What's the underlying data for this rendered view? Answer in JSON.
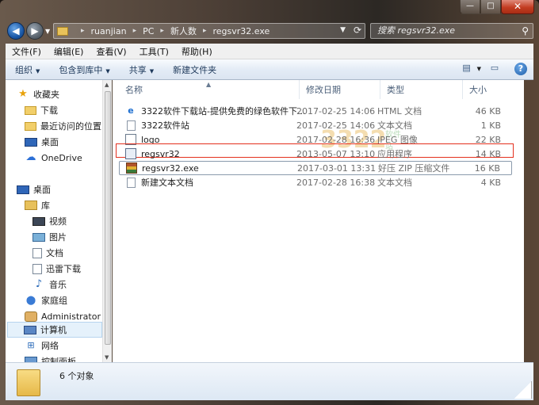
{
  "window": {
    "close_glyph": "✕",
    "min_glyph": "—",
    "max_glyph": "□"
  },
  "address": {
    "crumbs": [
      "ruanjian",
      "PC",
      "新人数",
      "regsvr32.exe"
    ],
    "separator": "▸"
  },
  "search": {
    "placeholder": "搜索 regsvr32.exe"
  },
  "menubar": [
    "文件(F)",
    "编辑(E)",
    "查看(V)",
    "工具(T)",
    "帮助(H)"
  ],
  "toolbar": {
    "organize": "组织",
    "include_in_library": "包含到库中",
    "share": "共享",
    "new_folder": "新建文件夹"
  },
  "navpane": {
    "favorites": "收藏夹",
    "downloads": "下载",
    "recent": "最近访问的位置",
    "desktop_fav": "桌面",
    "onedrive": "OneDrive",
    "desktop": "桌面",
    "libraries": "库",
    "videos": "视频",
    "pictures": "图片",
    "documents": "文档",
    "xunlei": "迅雷下载",
    "music": "音乐",
    "homegroup": "家庭组",
    "administrator": "Administrator",
    "computer": "计算机",
    "network": "网络",
    "control_panel": "控制面板"
  },
  "columns": {
    "name": "名称",
    "date": "修改日期",
    "type": "类型",
    "size": "大小"
  },
  "files": [
    {
      "name": "3322软件下载站-提供免费的绿色软件下...",
      "date": "2017-02-25 14:06",
      "type": "HTML 文档",
      "size": "46 KB",
      "icon": "ie-icon"
    },
    {
      "name": "3322软件站",
      "date": "2017-02-25 14:06",
      "type": "文本文档",
      "size": "1 KB",
      "icon": "text-file-icon"
    },
    {
      "name": "logo",
      "date": "2017-02-28 16:36",
      "type": "JPEG 图像",
      "size": "22 KB",
      "icon": "image-file-icon"
    },
    {
      "name": "regsvr32",
      "date": "2013-05-07 13:10",
      "type": "应用程序",
      "size": "14 KB",
      "icon": "exe-icon"
    },
    {
      "name": "regsvr32.exe",
      "date": "2017-03-01 13:31",
      "type": "好压 ZIP 压缩文件",
      "size": "16 KB",
      "icon": "zip-icon"
    },
    {
      "name": "新建文本文档",
      "date": "2017-02-28 16:38",
      "type": "文本文档",
      "size": "4 KB",
      "icon": "text-file-icon"
    }
  ],
  "watermark": {
    "digits": "3322",
    "text": "软件站"
  },
  "status": {
    "item_count": "6 个对象"
  },
  "colors": {
    "highlight": "#e4301e",
    "accent": "#1e395b"
  }
}
